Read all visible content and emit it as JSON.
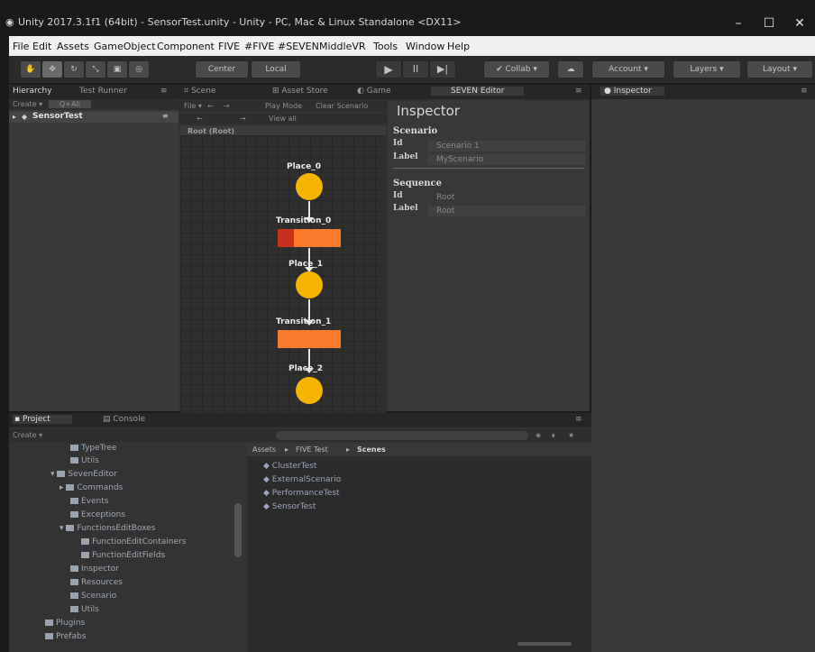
{
  "window": {
    "title": "Unity 2017.3.1f1 (64bit) - SensorTest.unity - Unity - PC, Mac & Linux Standalone <DX11>",
    "minimize": "–",
    "maximize": "☐",
    "close": "✕"
  },
  "menu": [
    "File",
    "Edit",
    "Assets",
    "GameObject",
    "Component",
    "FIVE",
    "#FIVE",
    "#SEVEN",
    "MiddleVR",
    "Tools",
    "Window",
    "Help"
  ],
  "toolbar": {
    "tools": [
      "hand-icon",
      "move-icon",
      "rotate-icon",
      "scale-icon",
      "rect-icon",
      "transform-icon"
    ],
    "pivot": "Center",
    "space": "Local",
    "play": "▶",
    "pause": "II",
    "step": "▶|",
    "collab": "Collab",
    "account": "Account",
    "layers": "Layers",
    "layout": "Layout"
  },
  "hierarchy": {
    "tabs": [
      "Hierarchy",
      "Test Runner"
    ],
    "create": "Create",
    "search": "Q+All",
    "scene": "SensorTest"
  },
  "center": {
    "tabs": [
      "Scene",
      "Asset Store",
      "Game",
      "SEVEN Editor"
    ],
    "toolbar": [
      "File",
      "Play Mode",
      "Clear Scenario"
    ],
    "nav": "←",
    "nav2": "→",
    "view_all": "View all",
    "breadcrumb": "Root (Root)",
    "places": [
      "Place_0",
      "Place_1",
      "Place_2"
    ],
    "transitions": [
      "Transition_0",
      "Transition_1"
    ],
    "transition_progress": [
      0.25,
      0
    ]
  },
  "seven_inspector": {
    "title": "Inspector",
    "scenario_heading": "Scenario",
    "scenario_id_label": "Id",
    "scenario_id": "Scenario 1",
    "scenario_label_label": "Label",
    "scenario_label": "MyScenario",
    "sequence_heading": "Sequence",
    "sequence_id_label": "Id",
    "sequence_id": "Root",
    "sequence_label_label": "Label",
    "sequence_label": "Root"
  },
  "inspector": {
    "tab": "Inspector"
  },
  "project": {
    "tabs": [
      "Project",
      "Console"
    ],
    "create": "Create",
    "tree": [
      "TypeTree",
      "Utils",
      "SevenEditor",
      "Commands",
      "Events",
      "Exceptions",
      "FunctionsEditBoxes",
      "FunctionEditContainers",
      "FunctionEditFields",
      "Inspector",
      "Resources",
      "Scenario",
      "Utils",
      "Plugins",
      "Prefabs"
    ],
    "breadcrumb": [
      "Assets",
      "FIVE Test",
      "Scenes"
    ],
    "assets": [
      "ClusterTest",
      "ExternalScenario",
      "PerformanceTest",
      "SensorTest"
    ]
  },
  "colors": {
    "place": "#f5b400",
    "transition": "#f97a2a",
    "transition_active": "#c9301c"
  }
}
